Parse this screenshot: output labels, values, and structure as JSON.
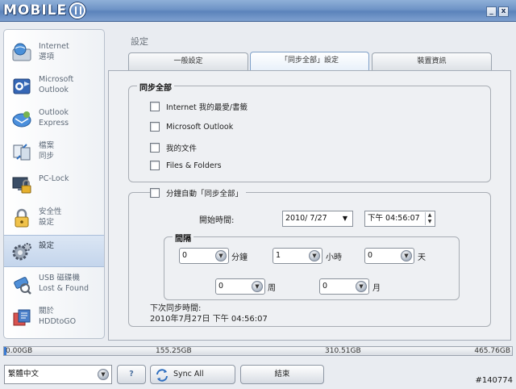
{
  "app": {
    "logo_text": "MOBILE",
    "minimize_label": "_",
    "close_label": "x"
  },
  "sidebar": {
    "items": [
      {
        "label": "Internet\n選項",
        "icon": "internet-options-icon"
      },
      {
        "label": "Microsoft\nOutlook",
        "icon": "outlook-icon"
      },
      {
        "label": "Outlook\nExpress",
        "icon": "outlook-express-icon"
      },
      {
        "label": "檔案\n同步",
        "icon": "file-sync-icon"
      },
      {
        "label": "PC-Lock",
        "icon": "pc-lock-icon"
      },
      {
        "label": "安全性\n設定",
        "icon": "security-lock-icon"
      },
      {
        "label": "設定",
        "icon": "settings-gear-icon",
        "active": true
      },
      {
        "label": "USB 磁碟機\nLost & Found",
        "icon": "usb-lost-found-icon"
      },
      {
        "label": "關於\nHDDtoGO",
        "icon": "about-icon"
      }
    ]
  },
  "main": {
    "section_title": "設定",
    "tabs": [
      {
        "label": "一般設定"
      },
      {
        "label": "「同步全部」設定",
        "active": true
      },
      {
        "label": "裝置資訊"
      }
    ],
    "sync_all": {
      "legend": "同步全部",
      "options": [
        {
          "label": "Internet 我的最愛/書籤",
          "checked": false
        },
        {
          "label": "Microsoft Outlook",
          "checked": false
        },
        {
          "label": "我的文件",
          "checked": false
        },
        {
          "label": "Files & Folders",
          "checked": false
        }
      ]
    },
    "schedule": {
      "checkbox_label": "分鐘自動「同步全部」",
      "checked": false,
      "start_time_label": "開始時間:",
      "start_date": "2010/ 7/27",
      "start_time": "下午 04:56:07",
      "interval": {
        "legend": "間隔",
        "minutes": {
          "value": "0",
          "unit": "分鐘"
        },
        "hours": {
          "value": "1",
          "unit": "小時"
        },
        "days": {
          "value": "0",
          "unit": "天"
        },
        "weeks": {
          "value": "0",
          "unit": "周"
        },
        "months": {
          "value": "0",
          "unit": "月"
        }
      },
      "next_sync_label": "下次同步時間:",
      "next_sync_value": "2010年7月27日 下午 04:56:07"
    }
  },
  "storage": {
    "used_fraction": 0.004,
    "fill_color": "#3a7bd5",
    "ticks": [
      "0.00GB",
      "155.25GB",
      "310.51GB",
      "465.76GB"
    ]
  },
  "toolbar": {
    "language": "繁體中文",
    "help_label": "?",
    "sync_all_label": "Sync All",
    "exit_label": "結束"
  },
  "watermark": "#140774"
}
